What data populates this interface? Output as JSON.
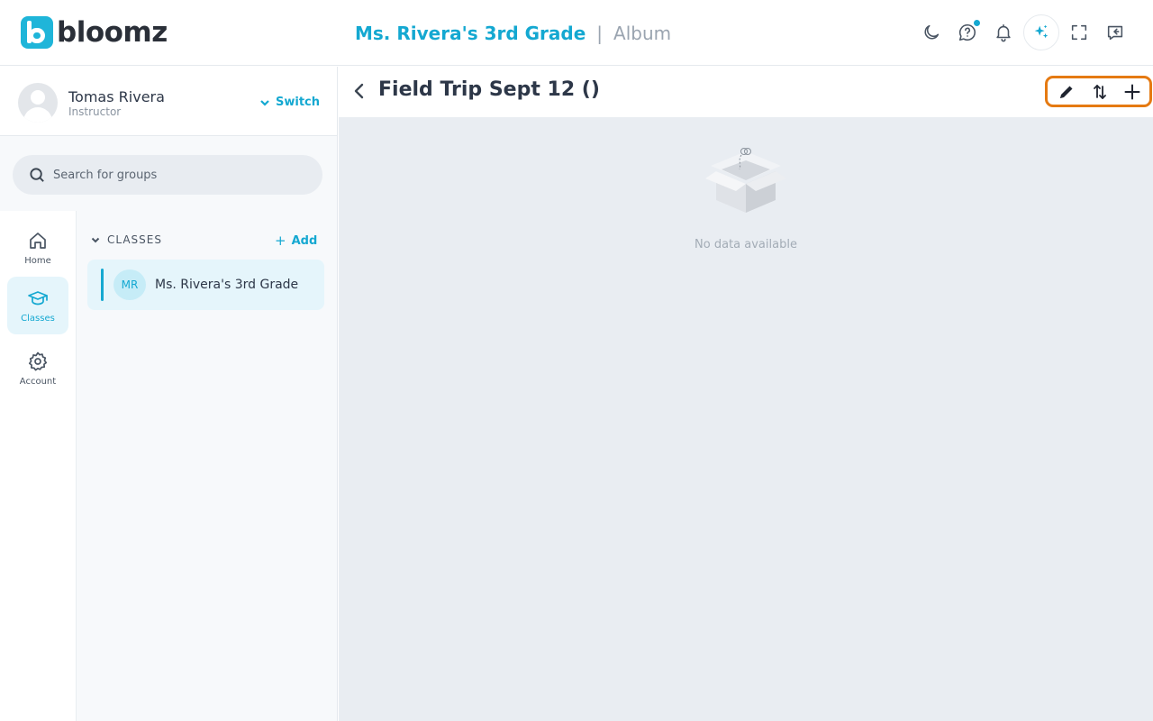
{
  "brand": {
    "name": "bloomz",
    "accent": "#14a8d1"
  },
  "header": {
    "group_name": "Ms. Rivera's 3rd Grade",
    "separator": "|",
    "section": "Album",
    "icons": [
      "moon-icon",
      "help-chat-icon",
      "bell-icon",
      "ai-sparkle-icon",
      "fullscreen-icon",
      "collapse-panel-icon"
    ]
  },
  "profile": {
    "name": "Tomas Rivera",
    "role": "Instructor",
    "switch_label": "Switch"
  },
  "search": {
    "placeholder": "Search for groups",
    "value": ""
  },
  "nav": {
    "items": [
      {
        "label": "Home",
        "icon": "home-icon",
        "active": false
      },
      {
        "label": "Classes",
        "icon": "graduation-cap-icon",
        "active": true
      },
      {
        "label": "Account",
        "icon": "gear-icon",
        "active": false
      }
    ]
  },
  "classes": {
    "header": "CLASSES",
    "add_label": "Add",
    "items": [
      {
        "initials": "MR",
        "name": "Ms. Rivera's 3rd Grade",
        "selected": true
      }
    ]
  },
  "album": {
    "title": "Field Trip Sept 12 ()",
    "actions": [
      "edit-pencil-icon",
      "sort-arrows-icon",
      "add-plus-icon"
    ],
    "highlight_color": "#e57a12",
    "empty_text": "No data available"
  }
}
